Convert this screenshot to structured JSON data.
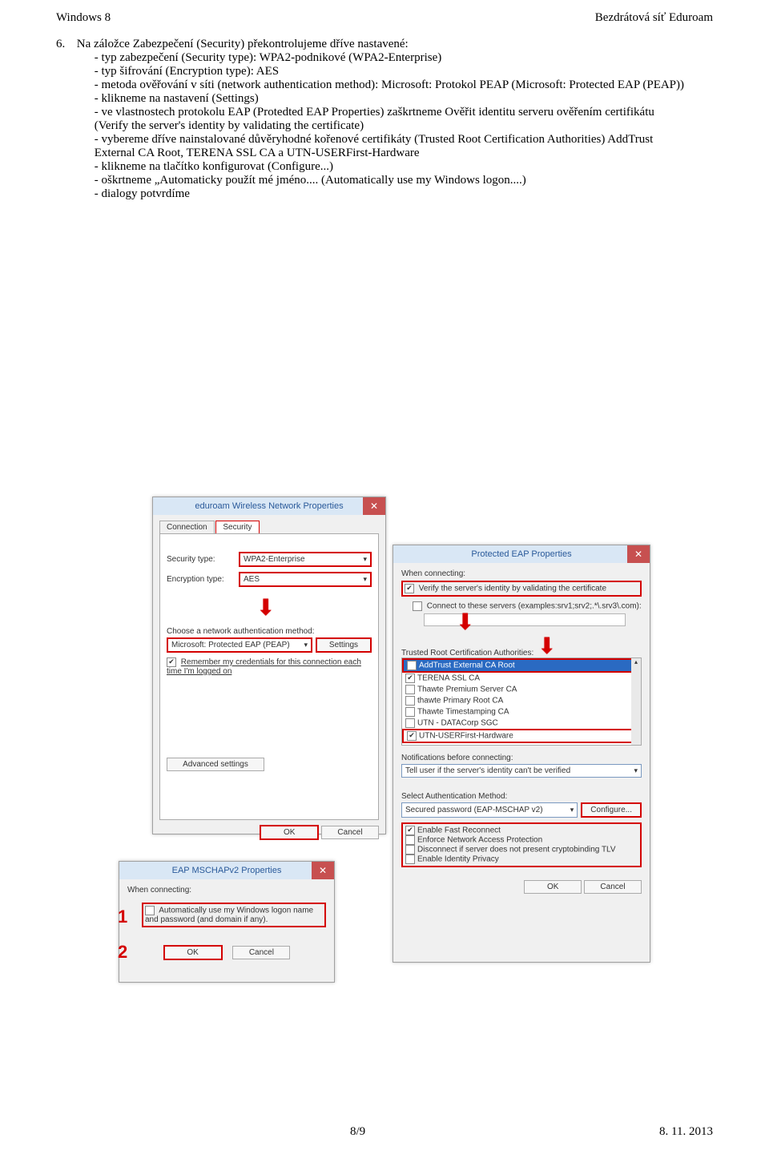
{
  "header": {
    "left": "Windows 8",
    "right": "Bezdrátová síť Eduroam"
  },
  "footer": {
    "page": "8/9",
    "date": "8. 11. 2013"
  },
  "doc": {
    "num": "6.",
    "line1": "Na záložce Zabezpečení (Security) překontrolujeme dříve nastavené:",
    "b1": "- typ zabezpečení (Security type): WPA2-podnikové (WPA2-Enterprise)",
    "b2": "- typ šifrování (Encryption type): AES",
    "b3": "- metoda ověřování v síti (network authentication method): Microsoft: Protokol PEAP (Microsoft: Protected EAP (PEAP))",
    "b4": "- klikneme na nastavení (Settings)",
    "b5": "- ve vlastnostech protokolu EAP (Protedted EAP Properties) zaškrtneme Ověřit identitu serveru ověřením certifikátu (Verify the server's identity by validating the certificate)",
    "b6": "- vybereme dříve nainstalované důvěryhodné kořenové certifikáty (Trusted Root Certification Authorities) AddTrust External CA Root, TERENA SSL CA a UTN-USERFirst-Hardware",
    "b7": "- klikneme na tlačítko konfigurovat (Configure...)",
    "b8": "- oškrtneme „Automaticky použít mé jméno.... (Automatically use my Windows logon....)",
    "b9": "- dialogy potvrdíme"
  },
  "dlg1": {
    "title": "eduroam Wireless Network Properties",
    "tab_connection": "Connection",
    "tab_security": "Security",
    "lbl_sectype": "Security type:",
    "val_sectype": "WPA2-Enterprise",
    "lbl_enctype": "Encryption type:",
    "val_enctype": "AES",
    "lbl_method": "Choose a network authentication method:",
    "val_method": "Microsoft: Protected EAP (PEAP)",
    "btn_settings": "Settings",
    "chk_remember": "Remember my credentials for this connection each time I'm logged on",
    "btn_adv": "Advanced settings",
    "ok": "OK",
    "cancel": "Cancel"
  },
  "dlg2": {
    "title": "Protected EAP Properties",
    "sec_when": "When connecting:",
    "chk_verify": "Verify the server's identity by validating the certificate",
    "chk_connect_servers": "Connect to these servers (examples:srv1;srv2;.*\\.srv3\\.com):",
    "lbl_trusted": "Trusted Root Certification Authorities:",
    "ca": [
      {
        "checked": true,
        "name": "AddTrust External CA Root",
        "hl": true
      },
      {
        "checked": true,
        "name": "TERENA SSL CA",
        "hl": false
      },
      {
        "checked": false,
        "name": "Thawte Premium Server CA",
        "hl": false
      },
      {
        "checked": false,
        "name": "thawte Primary Root CA",
        "hl": false
      },
      {
        "checked": false,
        "name": "Thawte Timestamping CA",
        "hl": false
      },
      {
        "checked": false,
        "name": "UTN - DATACorp SGC",
        "hl": false
      },
      {
        "checked": true,
        "name": "UTN-USERFirst-Hardware",
        "hl": true
      }
    ],
    "lbl_notif": "Notifications before connecting:",
    "val_notif": "Tell user if the server's identity can't be verified",
    "lbl_authmethod": "Select Authentication Method:",
    "val_authmethod": "Secured password (EAP-MSCHAP v2)",
    "btn_configure": "Configure...",
    "chk_fast": "Enable Fast Reconnect",
    "chk_nap": "Enforce Network Access Protection",
    "chk_crypto": "Disconnect if server does not present cryptobinding TLV",
    "chk_privacy": "Enable Identity Privacy",
    "ok": "OK",
    "cancel": "Cancel"
  },
  "dlg3": {
    "title": "EAP MSCHAPv2 Properties",
    "sec_when": "When connecting:",
    "chk_auto": "Automatically use my Windows logon name and password (and domain if any).",
    "ok": "OK",
    "cancel": "Cancel",
    "badge1": "1",
    "badge2": "2"
  }
}
